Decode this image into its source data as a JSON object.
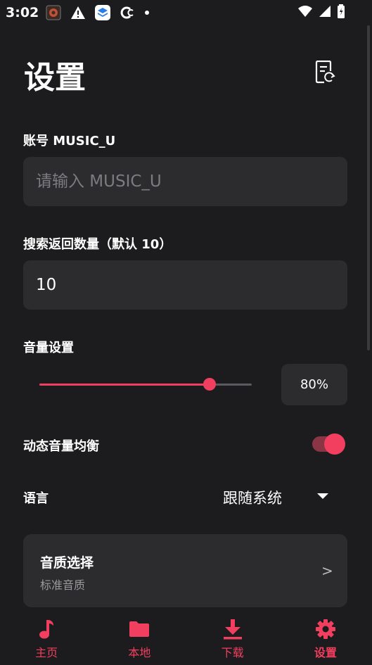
{
  "status_bar": {
    "time": "3:02"
  },
  "header": {
    "title": "设置"
  },
  "account": {
    "label": "账号 MUSIC_U",
    "value": "",
    "placeholder": "请输入 MUSIC_U"
  },
  "search_count": {
    "label": "搜索返回数量（默认 10）",
    "value": "10"
  },
  "volume": {
    "label": "音量设置",
    "level": 0.8,
    "display": "80%"
  },
  "dynamic_volume": {
    "label": "动态音量均衡",
    "enabled": true
  },
  "language": {
    "label": "语言",
    "selected": "跟随系统"
  },
  "quality": {
    "title": "音质选择",
    "subtitle": "标准音质",
    "chevron": ">"
  },
  "bottom_nav": {
    "items": [
      {
        "label": "主页",
        "icon": "music-note-icon"
      },
      {
        "label": "本地",
        "icon": "folder-icon"
      },
      {
        "label": "下载",
        "icon": "download-icon"
      },
      {
        "label": "设置",
        "icon": "gear-icon"
      }
    ],
    "active_index": 3
  },
  "colors": {
    "accent": "#f23f5f",
    "background": "#1c1c1e",
    "surface": "#2c2c2e"
  }
}
